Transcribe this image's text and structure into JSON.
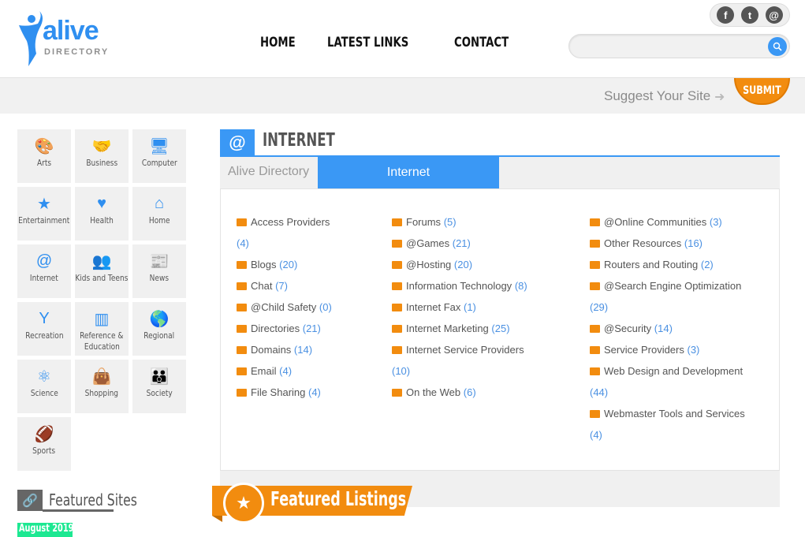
{
  "header": {
    "logo_word": "alive",
    "logo_sub": "DIRECTORY",
    "nav": [
      "HOME",
      "LATEST LINKS",
      "CONTACT"
    ],
    "social": [
      {
        "icon": "facebook-icon",
        "glyph": "f"
      },
      {
        "icon": "twitter-icon",
        "glyph": "t"
      },
      {
        "icon": "email-icon",
        "glyph": "@"
      }
    ],
    "search": {
      "value": "",
      "placeholder": ""
    }
  },
  "suggest": {
    "text": "Suggest Your Site",
    "submit_label": "SUBMIT"
  },
  "sidebar": {
    "categories": [
      {
        "label": "Arts",
        "icon": "palette-icon",
        "glyph": "🎨"
      },
      {
        "label": "Business",
        "icon": "handshake-icon",
        "glyph": "🤝"
      },
      {
        "label": "Computer",
        "icon": "desktop-icon",
        "glyph": "🖥"
      },
      {
        "label": "Entertainment",
        "icon": "stars-icon",
        "glyph": "★"
      },
      {
        "label": "Health",
        "icon": "heart-icon",
        "glyph": "♥"
      },
      {
        "label": "Home",
        "icon": "house-icon",
        "glyph": "⌂"
      },
      {
        "label": "Internet",
        "icon": "at-icon",
        "glyph": "@"
      },
      {
        "label": "Kids and Teens",
        "icon": "kids-icon",
        "glyph": "👥"
      },
      {
        "label": "News",
        "icon": "newspaper-icon",
        "glyph": "📰"
      },
      {
        "label": "Recreation",
        "icon": "person-arms-up-icon",
        "glyph": "Y"
      },
      {
        "label": "Reference &",
        "label2": "Education",
        "icon": "books-icon",
        "glyph": "▥"
      },
      {
        "label": "Regional",
        "icon": "globe-icon",
        "glyph": "🌎"
      },
      {
        "label": "Science",
        "icon": "atom-icon",
        "glyph": "⚛"
      },
      {
        "label": "Shopping",
        "icon": "shopping-bag-icon",
        "glyph": "👜"
      },
      {
        "label": "Society",
        "icon": "group-icon",
        "glyph": "👪"
      },
      {
        "label": "Sports",
        "icon": "football-icon",
        "glyph": "🏈"
      }
    ],
    "featured_sites_title": "Featured Sites",
    "featured_date": "August 2019"
  },
  "main": {
    "title": "INTERNET",
    "breadcrumb": [
      "Alive Directory",
      "Internet"
    ],
    "columns": [
      [
        {
          "name": "Access Providers",
          "count": "(4)",
          "wrap": true
        },
        {
          "name": "Blogs",
          "count": "(20)"
        },
        {
          "name": "Chat",
          "count": "(7)"
        },
        {
          "name": "@Child Safety",
          "count": "(0)"
        },
        {
          "name": "Directories",
          "count": "(21)"
        },
        {
          "name": "Domains",
          "count": "(14)"
        },
        {
          "name": "Email",
          "count": "(4)"
        },
        {
          "name": "File Sharing",
          "count": "(4)"
        }
      ],
      [
        {
          "name": "Forums",
          "count": "(5)"
        },
        {
          "name": "@Games",
          "count": "(21)"
        },
        {
          "name": "@Hosting",
          "count": "(20)"
        },
        {
          "name": "Information Technology",
          "count": "(8)"
        },
        {
          "name": "Internet Fax",
          "count": "(1)"
        },
        {
          "name": "Internet Marketing",
          "count": "(25)"
        },
        {
          "name": "Internet Service Providers",
          "count": "(10)",
          "wrap": true
        },
        {
          "name": "On the Web",
          "count": "(6)"
        }
      ],
      [
        {
          "name": "@Online Communities",
          "count": "(3)"
        },
        {
          "name": "Other Resources",
          "count": "(16)"
        },
        {
          "name": "Routers and Routing",
          "count": "(2)"
        },
        {
          "name": "@Search Engine Optimization",
          "count": "(29)",
          "wrap": true
        },
        {
          "name": "@Security",
          "count": "(14)"
        },
        {
          "name": "Service Providers",
          "count": "(3)"
        },
        {
          "name": "Web Design and Development",
          "count": "(44)",
          "wrap": true
        },
        {
          "name": "Webmaster Tools and Services",
          "count": "(4)",
          "wrap": true
        }
      ]
    ],
    "featured_listings_title": "Featured Listings"
  },
  "colors": {
    "accent_blue": "#3a98f5",
    "accent_orange": "#f28c0f",
    "date_green": "#1de892"
  }
}
